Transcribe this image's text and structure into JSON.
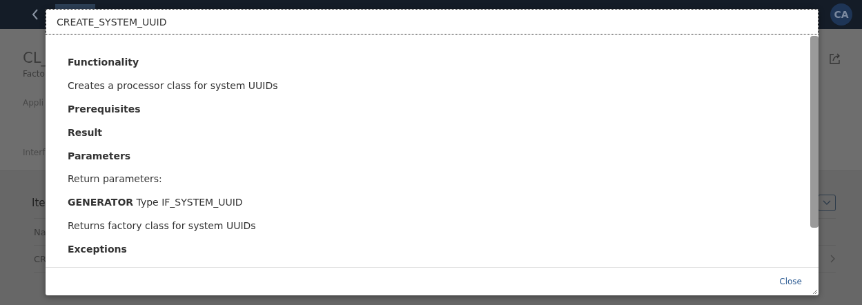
{
  "header": {
    "avatar": "CA"
  },
  "background": {
    "title": "CL_",
    "subtitle": "Facto",
    "field_label": "Appli",
    "section_label": "Interf",
    "table_title": "Ite",
    "column_header": "Na",
    "row_cell": "CR"
  },
  "dialog": {
    "title": "CREATE_SYSTEM_UUID",
    "content": [
      {
        "kind": "heading",
        "text": "Functionality"
      },
      {
        "kind": "paragraph",
        "text": "Creates a processor class for system UUIDs"
      },
      {
        "kind": "heading",
        "text": "Prerequisites"
      },
      {
        "kind": "heading",
        "text": "Result"
      },
      {
        "kind": "heading",
        "text": "Parameters"
      },
      {
        "kind": "paragraph",
        "text": "Return parameters:"
      },
      {
        "kind": "paragraph",
        "text": "**GENERATOR** Type IF_SYSTEM_UUID"
      },
      {
        "kind": "paragraph",
        "text": "Returns factory class for system UUIDs"
      },
      {
        "kind": "heading",
        "text": "Exceptions"
      }
    ],
    "close": "Close"
  }
}
